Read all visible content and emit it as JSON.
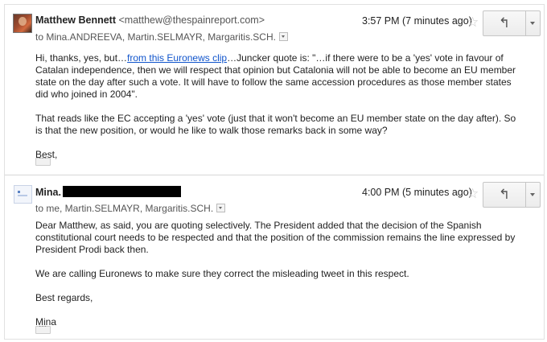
{
  "messages": [
    {
      "sender_name": "Matthew Bennett",
      "sender_email": "<matthew@thespainreport.com>",
      "recipients": "to Mina.ANDREEVA, Martin.SELMAYR, Margaritis.SCH.",
      "time": "3:57 PM (7 minutes ago)",
      "paragraphs": {
        "p1_before_link": "Hi, thanks, yes, but…",
        "p1_link": "from this Euronews clip",
        "p1_after_link": "…Juncker quote is: \"…if there were to be a 'yes' vote in favour of Catalan independence, then we will respect that opinion but Catalonia will not be able to become an EU member state on the day after such a vote. It will have to follow the same accession procedures as those member states did who joined in 2004\".",
        "p2": "That reads like the EC accepting a 'yes' vote (just that it won't become an EU member state on the day after). So is that the new position, or would he like to walk those remarks back in some way?",
        "p3": "Best,"
      }
    },
    {
      "sender_name": "Mina.",
      "recipients": "to me, Martin.SELMAYR, Margaritis.SCH.",
      "time": "4:00 PM (5 minutes ago)",
      "paragraphs": {
        "p1": "Dear Matthew, as said, you are quoting selectively. The President added that the decision of the Spanish constitutional court needs to be respected and that the position of the commission remains the line expressed by President Prodi back then.",
        "p2": "We are calling Euronews to make sure they correct the misleading tweet in this respect.",
        "p3": "Best regards,",
        "p4": "Mina"
      }
    }
  ],
  "icons": {
    "star": "☆",
    "reply": "↰",
    "ellipsis": "···"
  }
}
